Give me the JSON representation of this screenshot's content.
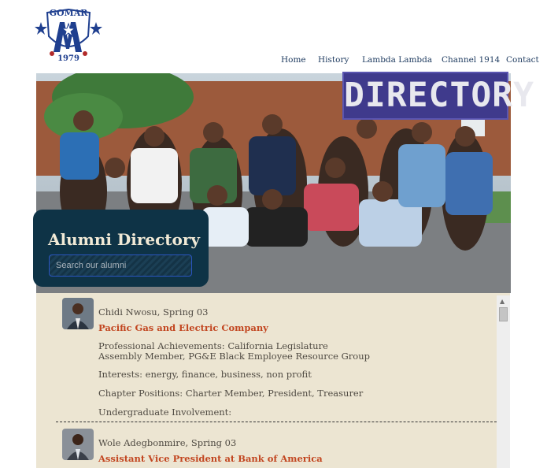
{
  "logo": {
    "lettering_top": "GOMAR",
    "lettering_bottom": "1979"
  },
  "nav": {
    "items": [
      {
        "label": "Home",
        "name": "nav-home"
      },
      {
        "label": "History",
        "name": "nav-history"
      },
      {
        "label": "Lambda Lambda",
        "name": "nav-lambda-lambda"
      },
      {
        "label": "Channel 1914",
        "name": "nav-channel-1914"
      },
      {
        "label": "Contact",
        "name": "nav-contact"
      }
    ]
  },
  "hero": {
    "stamp_text": "DIRECTORY"
  },
  "search": {
    "title": "Alumni Directory",
    "placeholder": "Search our alumni"
  },
  "alumni": [
    {
      "name": "Chidi Nwosu, Spring 03",
      "org": "Pacific Gas and Electric Company",
      "achievements": "Professional Achievements: California Legislature Assembly Member, PG&E Black Employee Resource Group",
      "interests": "Interests: energy, finance, business, non profit",
      "positions": "Chapter Positions: Charter Member, President, Treasurer",
      "involvement": "Undergraduate Involvement:"
    },
    {
      "name": "Wole Adegbonmire, Spring 03",
      "org": "Assistant Vice President at Bank of America"
    }
  ],
  "colors": {
    "nav": "#1d3a5f",
    "card": "#0e3346",
    "panel": "#ece5d2",
    "accent": "#c24620",
    "stamp": "#3f3a8c"
  }
}
